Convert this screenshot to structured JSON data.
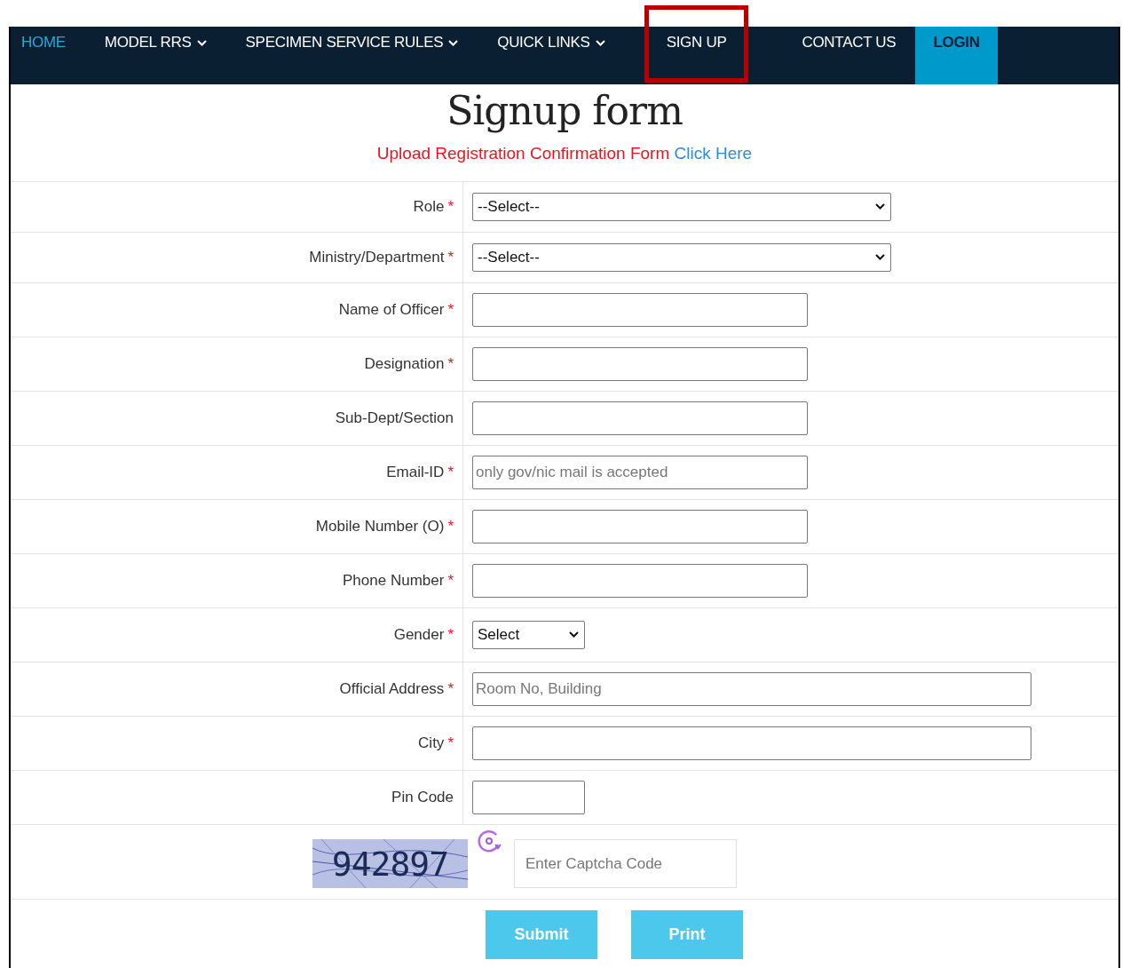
{
  "nav": [
    {
      "label": "HOME",
      "dropdown": false,
      "selected": true,
      "kind": "link",
      "highlighted": false
    },
    {
      "label": "MODEL RRS",
      "dropdown": true,
      "selected": false,
      "kind": "link",
      "highlighted": false
    },
    {
      "label": "SPECIMEN SERVICE RULES",
      "dropdown": true,
      "selected": false,
      "kind": "link",
      "highlighted": false
    },
    {
      "label": "QUICK LINKS",
      "dropdown": true,
      "selected": false,
      "kind": "link",
      "highlighted": false
    },
    {
      "label": "SIGN UP",
      "dropdown": false,
      "selected": false,
      "kind": "link",
      "highlighted": true
    },
    {
      "label": "CONTACT US",
      "dropdown": false,
      "selected": false,
      "kind": "link",
      "highlighted": false
    },
    {
      "label": "LOGIN",
      "dropdown": false,
      "selected": false,
      "kind": "button",
      "highlighted": false
    }
  ],
  "title": "Signup form",
  "notice": {
    "text": "Upload Registration Confirmation Form",
    "link": "Click Here"
  },
  "fields": [
    {
      "label": "Role",
      "mark": "*",
      "kind": "select",
      "value": "--Select--"
    },
    {
      "label": "Ministry/Department",
      "mark": "*",
      "kind": "select",
      "value": "--Select--"
    },
    {
      "label": "Name of Officer",
      "mark": "*",
      "kind": "text"
    },
    {
      "label": "Designation",
      "mark": "*",
      "kind": "text"
    },
    {
      "label": "Sub-Dept/Section",
      "kind": "text"
    },
    {
      "label": "Email-ID",
      "mark": "*",
      "kind": "text",
      "placeholder": "only gov/nic mail is accepted"
    },
    {
      "label": "Mobile Number (O)",
      "mark": "*",
      "kind": "text"
    },
    {
      "label": "Phone Number",
      "mark": "*",
      "kind": "text"
    },
    {
      "label": "Gender",
      "mark": "*",
      "kind": "short-select",
      "value": "Select"
    },
    {
      "label": "Official Address",
      "mark": "*",
      "kind": "long-text",
      "placeholder": "Room No, Building"
    },
    {
      "label": "City",
      "mark": "*",
      "kind": "long-text"
    },
    {
      "label": "Pin Code",
      "kind": "short-text"
    }
  ],
  "captcha": {
    "code": "942897",
    "placeholder": "Enter Captcha Code"
  },
  "buttons": [
    "Submit",
    "Print"
  ]
}
